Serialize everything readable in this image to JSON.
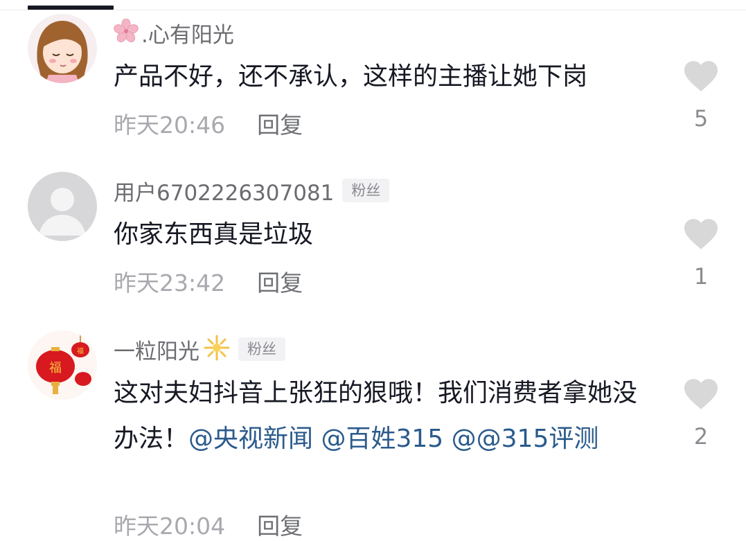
{
  "comments": [
    {
      "username": ".心有阳光",
      "badge": "",
      "text": "产品不好，还不承认，这样的主播让她下岗",
      "time": "昨天20:46",
      "reply_label": "回复",
      "likes": "5",
      "avatar_icon": "cartoon-girl-avatar",
      "name_icon": "sakura-flower-icon"
    },
    {
      "username": "用户6702226307081",
      "badge": "粉丝",
      "text": "你家东西真是垃圾",
      "time": "昨天23:42",
      "reply_label": "回复",
      "likes": "1",
      "avatar_icon": "default-user-avatar"
    },
    {
      "username": "一粒阳光",
      "badge": "粉丝",
      "text_plain": "这对夫妇抖音上张狂的狠哦！我们消费者拿她没办法！",
      "mentions": [
        "@央视新闻",
        "@百姓315",
        "@@315评测"
      ],
      "time": "昨天20:04",
      "reply_label": "回复",
      "likes": "2",
      "avatar_icon": "red-lantern-fu-avatar",
      "name_icon": "sun-sparkle-icon",
      "mention_color": "#2a5a8c"
    }
  ],
  "colors": {
    "username": "#6b6b70",
    "time": "#a8a9ae",
    "like_heart": "#d8d8d8"
  }
}
